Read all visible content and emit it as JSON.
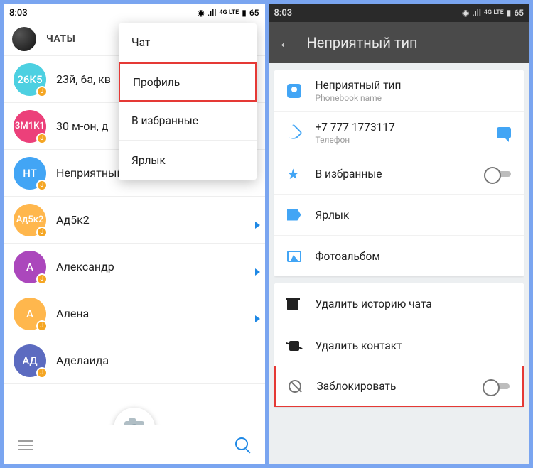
{
  "status": {
    "time": "8:03",
    "network": "4G LTE",
    "battery": "65",
    "wifi": "●",
    "signal": "●"
  },
  "left": {
    "tab_left": "ЧАТЫ",
    "contacts": [
      {
        "initials": "26К5",
        "color": "#4dd0e1",
        "name": "23й, 6а, кв"
      },
      {
        "initials": "3М1К1",
        "color": "#ec407a",
        "name": "30 м-он, д"
      },
      {
        "initials": "НТ",
        "color": "#42a5f5",
        "name": "Неприятный тип"
      },
      {
        "initials": "Ад5к2",
        "color": "#ffb74d",
        "name": "Ад5к2",
        "cam": true
      },
      {
        "initials": "А",
        "color": "#ab47bc",
        "name": "Александр",
        "cam": true
      },
      {
        "initials": "А",
        "color": "#ffb74d",
        "name": "Алена",
        "cam": true
      },
      {
        "initials": "АД",
        "color": "#5c6bc0",
        "name": "Аделаида"
      }
    ],
    "popup": {
      "chat": "Чат",
      "profile": "Профиль",
      "fav": "В избранные",
      "shortcut": "Ярлык"
    }
  },
  "right": {
    "title": "Неприятный тип",
    "contact_name": "Неприятный тип",
    "contact_sub": "Phonebook name",
    "phone_number": "+7 777 1773117",
    "phone_label": "Телефон",
    "favorite": "В избранные",
    "shortcut": "Ярлык",
    "photos": "Фотоальбом",
    "clear_history": "Удалить историю чата",
    "delete_contact": "Удалить контакт",
    "block": "Заблокировать"
  }
}
